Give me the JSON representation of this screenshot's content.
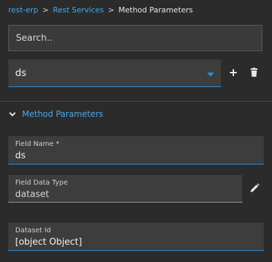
{
  "breadcrumb": {
    "items": [
      "rest-erp",
      "Rest Services"
    ],
    "separator": ">",
    "current": "Method Parameters"
  },
  "search": {
    "placeholder": "Search..",
    "value": ""
  },
  "method_select": {
    "value": "ds"
  },
  "section": {
    "title": "Method Parameters"
  },
  "fields": {
    "field_name": {
      "label": "Field Name *",
      "value": "ds"
    },
    "field_data_type": {
      "label": "Field Data Type",
      "value": "dataset"
    },
    "dataset_id": {
      "label": "Dataset Id",
      "value": "[object Object]"
    }
  },
  "colors": {
    "accent": "#4aa8e8",
    "underline": "#2f8fd8",
    "background": "#2b2b2b",
    "field_bg": "#3d3d3d"
  },
  "icons": [
    "plus-icon",
    "trash-icon",
    "chevron-down-icon",
    "pencil-icon",
    "caret-down-icon"
  ]
}
